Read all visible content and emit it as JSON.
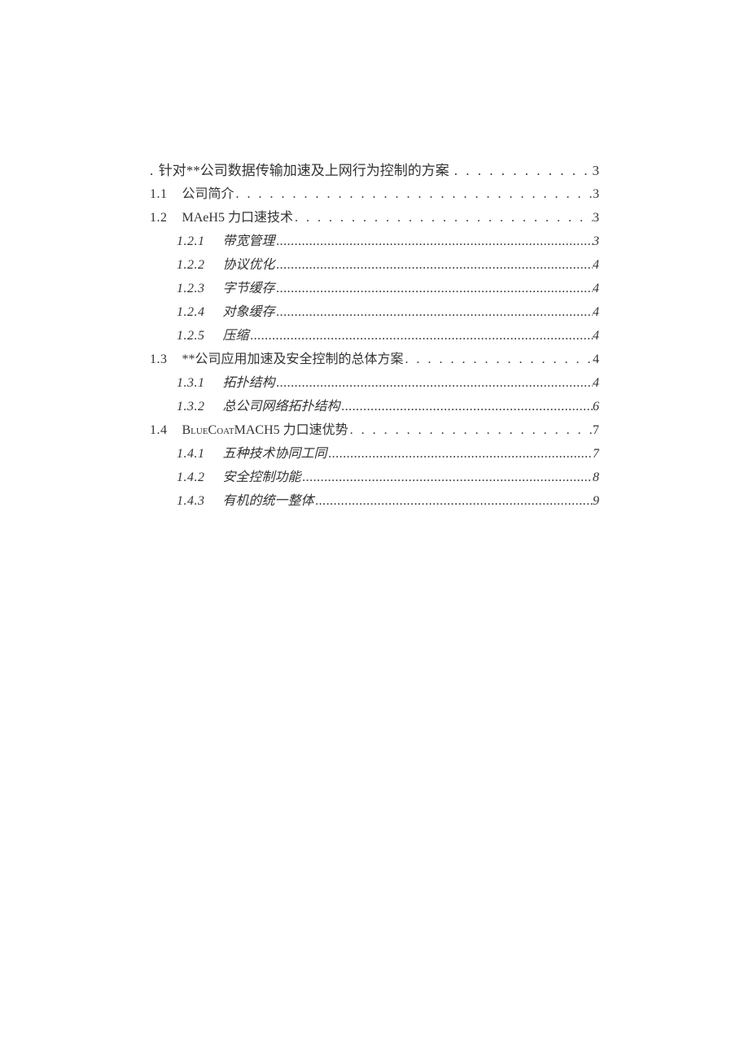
{
  "toc": [
    {
      "level": "a",
      "num": ".",
      "title": "针对**公司数据传输加速及上网行为控制的方案",
      "page": "3",
      "leader": "dotted"
    },
    {
      "level": "b",
      "num": "1.1",
      "title": "公司简介",
      "page": "3",
      "leader": "dotted"
    },
    {
      "level": "b",
      "num": "1.2",
      "title": "MAeH5 力口速技术",
      "page": "3",
      "leader": "dotted"
    },
    {
      "level": "c",
      "num": "1.2.1",
      "title": "带宽管理",
      "page": "3",
      "leader": "tight"
    },
    {
      "level": "c",
      "num": "1.2.2",
      "title": "协议优化",
      "page": "4",
      "leader": "tight"
    },
    {
      "level": "c",
      "num": "1.2.3",
      "title": "字节缓存",
      "page": "4",
      "leader": "tight"
    },
    {
      "level": "c",
      "num": "1.2.4",
      "title": "对象缓存",
      "page": "4",
      "leader": "tight"
    },
    {
      "level": "c",
      "num": "1.2.5",
      "title": "压缩",
      "page": "4",
      "leader": "tight"
    },
    {
      "level": "b",
      "num": "1.3",
      "title": "**公司应用加速及安全控制的总体方案",
      "page": "4",
      "leader": "dotted"
    },
    {
      "level": "c",
      "num": "1.3.1",
      "title": "拓扑结构",
      "page": "4",
      "leader": "tight"
    },
    {
      "level": "c",
      "num": "1.3.2",
      "title": "总公司网络拓扑结构",
      "page": "6",
      "leader": "tight"
    },
    {
      "level": "b",
      "num": "1.4",
      "title": "BlueCoatMACH5 力口速优势",
      "page": "7",
      "leader": "dotted",
      "sc": true
    },
    {
      "level": "c",
      "num": "1.4.1",
      "title": "五种技术协同工同",
      "page": "7",
      "leader": "tight"
    },
    {
      "level": "c",
      "num": "1.4.2",
      "title": "安全控制功能",
      "page": "8",
      "leader": "tight"
    },
    {
      "level": "c",
      "num": "1.4.3",
      "title": "有机的统一整体",
      "page": "9",
      "leader": "tight"
    }
  ]
}
